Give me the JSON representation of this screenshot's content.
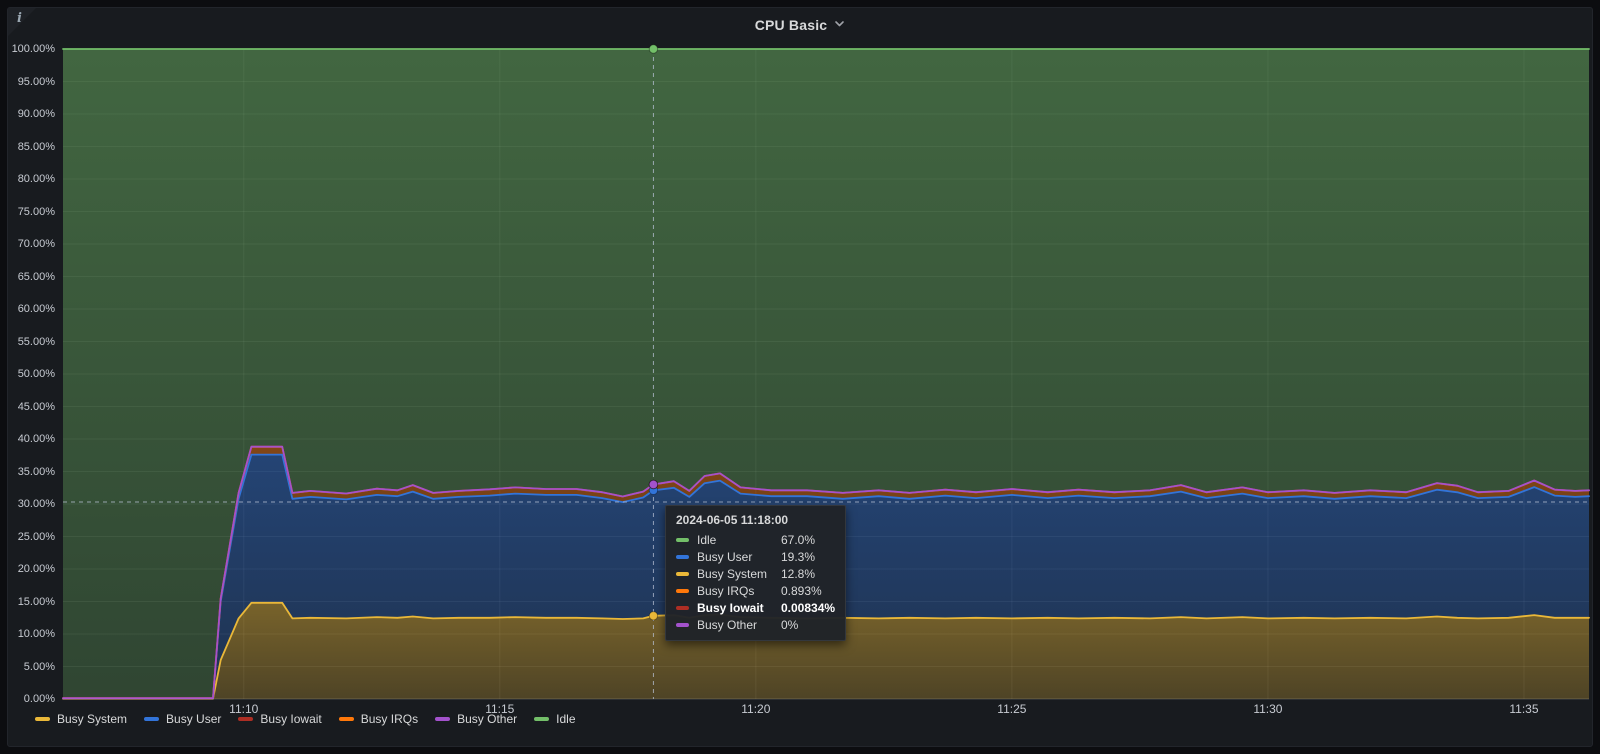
{
  "panel": {
    "title": "CPU Basic",
    "info_corner_glyph": "i"
  },
  "chart_data": {
    "type": "area",
    "stacked": true,
    "title": "CPU Basic",
    "ylabel": "",
    "xlabel": "",
    "unit": "percent",
    "ylim": [
      0,
      100
    ],
    "xlim_minutes_after_1100": [
      6.47,
      36.27
    ],
    "grid": true,
    "legend_position": "bottom",
    "y_ticks": [
      {
        "value": 0,
        "label": "0.00%"
      },
      {
        "value": 5,
        "label": "5.00%"
      },
      {
        "value": 10,
        "label": "10.00%"
      },
      {
        "value": 15,
        "label": "15.00%"
      },
      {
        "value": 20,
        "label": "20.00%"
      },
      {
        "value": 25,
        "label": "25.00%"
      },
      {
        "value": 30,
        "label": "30.00%"
      },
      {
        "value": 35,
        "label": "35.00%"
      },
      {
        "value": 40,
        "label": "40.00%"
      },
      {
        "value": 45,
        "label": "45.00%"
      },
      {
        "value": 50,
        "label": "50.00%"
      },
      {
        "value": 55,
        "label": "55.00%"
      },
      {
        "value": 60,
        "label": "60.00%"
      },
      {
        "value": 65,
        "label": "65.00%"
      },
      {
        "value": 70,
        "label": "70.00%"
      },
      {
        "value": 75,
        "label": "75.00%"
      },
      {
        "value": 80,
        "label": "80.00%"
      },
      {
        "value": 85,
        "label": "85.00%"
      },
      {
        "value": 90,
        "label": "90.00%"
      },
      {
        "value": 95,
        "label": "95.00%"
      },
      {
        "value": 100,
        "label": "100.00%"
      }
    ],
    "x_ticks": [
      {
        "value": 10,
        "label": "11:10"
      },
      {
        "value": 15,
        "label": "11:15"
      },
      {
        "value": 20,
        "label": "11:20"
      },
      {
        "value": 25,
        "label": "11:25"
      },
      {
        "value": 30,
        "label": "11:30"
      },
      {
        "value": 35,
        "label": "11:35"
      }
    ],
    "x": [
      6.47,
      9.4,
      9.55,
      9.9,
      10.15,
      10.75,
      10.95,
      11.3,
      12.0,
      12.6,
      13.0,
      13.3,
      13.7,
      14.2,
      14.8,
      15.3,
      15.9,
      16.5,
      17.0,
      17.4,
      17.8,
      18.0,
      18.4,
      18.7,
      19.0,
      19.3,
      19.7,
      20.3,
      21.0,
      21.7,
      22.4,
      23.0,
      23.7,
      24.3,
      25.0,
      25.7,
      26.3,
      27.0,
      27.7,
      28.3,
      28.8,
      29.5,
      30.0,
      30.7,
      31.3,
      32.0,
      32.7,
      33.3,
      33.7,
      34.1,
      34.7,
      35.2,
      35.6,
      36.0,
      36.27
    ],
    "series": [
      {
        "name": "Busy System",
        "color": "#EAB839",
        "values": [
          0.05,
          0.05,
          6.0,
          12.4,
          14.8,
          14.8,
          12.4,
          12.5,
          12.4,
          12.6,
          12.5,
          12.7,
          12.4,
          12.5,
          12.5,
          12.6,
          12.5,
          12.5,
          12.4,
          12.3,
          12.4,
          12.8,
          12.9,
          12.5,
          12.9,
          13.0,
          12.6,
          12.5,
          12.4,
          12.5,
          12.4,
          12.5,
          12.4,
          12.5,
          12.4,
          12.5,
          12.4,
          12.5,
          12.4,
          12.6,
          12.4,
          12.6,
          12.4,
          12.5,
          12.4,
          12.5,
          12.4,
          12.7,
          12.5,
          12.4,
          12.5,
          12.9,
          12.5,
          12.5,
          12.5
        ]
      },
      {
        "name": "Busy User",
        "color": "#3274D9",
        "values": [
          0.05,
          0.05,
          9.0,
          18.4,
          22.8,
          22.8,
          18.4,
          18.6,
          18.3,
          18.8,
          18.7,
          19.2,
          18.4,
          18.6,
          18.8,
          19.0,
          18.9,
          18.9,
          18.5,
          18.0,
          18.6,
          19.3,
          19.6,
          18.6,
          20.3,
          20.6,
          19.0,
          18.7,
          18.8,
          18.3,
          18.8,
          18.3,
          18.9,
          18.4,
          19.0,
          18.4,
          18.9,
          18.4,
          18.8,
          19.3,
          18.5,
          19.0,
          18.5,
          18.7,
          18.4,
          18.7,
          18.5,
          19.5,
          19.3,
          18.5,
          18.6,
          19.7,
          18.8,
          18.6,
          18.7
        ]
      },
      {
        "name": "Busy IRQs",
        "color": "#FF780A",
        "values": [
          0.02,
          0.02,
          0.45,
          0.9,
          1.2,
          1.2,
          0.9,
          0.9,
          0.9,
          0.95,
          0.9,
          1.0,
          0.9,
          0.9,
          0.95,
          0.95,
          0.9,
          0.9,
          0.9,
          0.85,
          0.9,
          0.893,
          1.0,
          0.9,
          1.1,
          1.1,
          0.95,
          0.9,
          0.9,
          0.9,
          0.9,
          0.9,
          0.9,
          0.9,
          0.9,
          0.9,
          0.9,
          0.9,
          0.9,
          1.0,
          0.9,
          0.95,
          0.9,
          0.9,
          0.9,
          0.9,
          0.9,
          1.0,
          1.0,
          0.9,
          0.9,
          1.0,
          0.9,
          0.9,
          0.9
        ]
      },
      {
        "name": "Busy Iowait",
        "color": "#AD2E24",
        "values": 0.01
      },
      {
        "name": "Busy Other",
        "color": "#A352CC",
        "values": 0
      },
      {
        "name": "Idle",
        "color": "#73BF69",
        "values": "remainder-to-100"
      }
    ],
    "legend_order": [
      "Busy System",
      "Busy User",
      "Busy Iowait",
      "Busy IRQs",
      "Busy Other",
      "Idle"
    ],
    "crosshair": {
      "x": 18,
      "y": 30.3
    }
  },
  "tooltip": {
    "timestamp": "2024-06-05 11:18:00",
    "rows": [
      {
        "label": "Idle",
        "value": "67.0%",
        "color": "#73BF69",
        "bold": false
      },
      {
        "label": "Busy User",
        "value": "19.3%",
        "color": "#3274D9",
        "bold": false
      },
      {
        "label": "Busy System",
        "value": "12.8%",
        "color": "#EAB839",
        "bold": false
      },
      {
        "label": "Busy IRQs",
        "value": "0.893%",
        "color": "#FF780A",
        "bold": false
      },
      {
        "label": "Busy Iowait",
        "value": "0.00834%",
        "color": "#AD2E24",
        "bold": true
      },
      {
        "label": "Busy Other",
        "value": "0%",
        "color": "#A352CC",
        "bold": false
      }
    ]
  },
  "colors": {
    "page_bg": "#0c0d10",
    "panel_bg": "#181b1f",
    "text": "#d8d9da",
    "axis_text": "#c7cbd2",
    "grid": "rgba(255,255,255,0.07)",
    "crosshair": "rgba(185,195,215,0.75)"
  }
}
